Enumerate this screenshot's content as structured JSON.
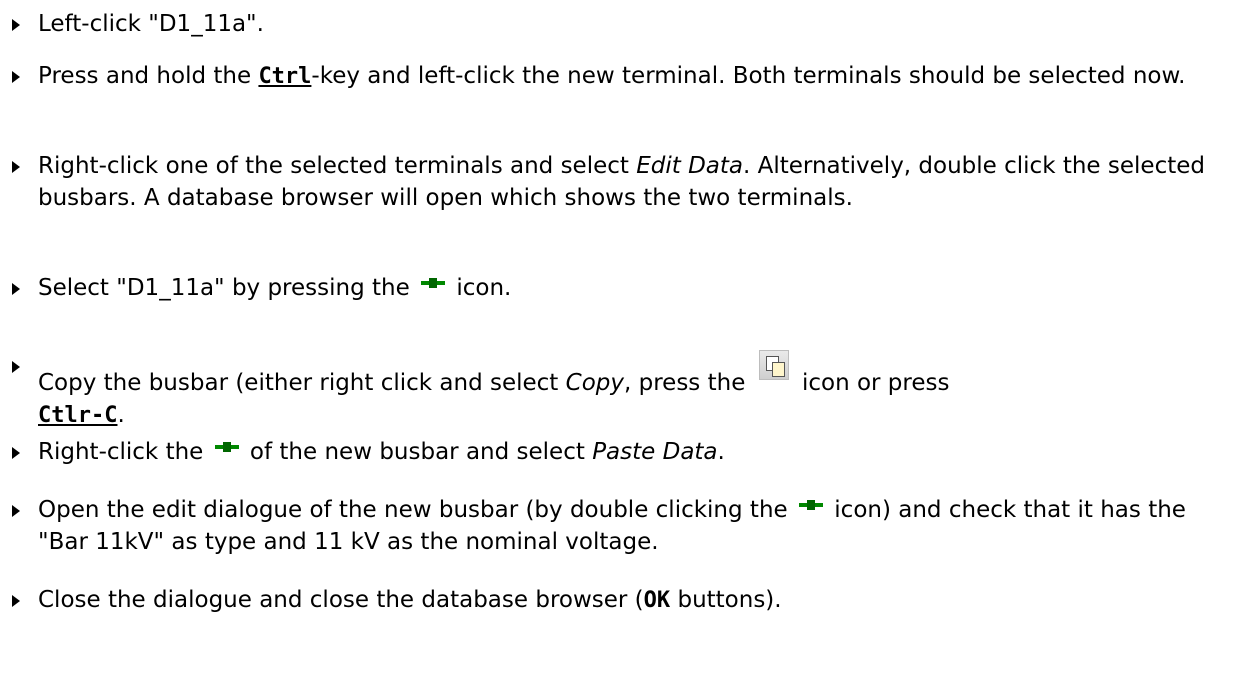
{
  "steps": [
    {
      "t1": "Left-click \"D1_11a\"."
    },
    {
      "t1": "Press and hold the ",
      "key": "Ctrl",
      "t2": "-key and left-click the new terminal. Both terminals should be selected now."
    },
    {
      "t1": "Right-click one of the selected terminals and select ",
      "em": "Edit Data",
      "t2": ". Alternatively, double click the selected busbars. A database browser will open which shows the two terminals."
    },
    {
      "t1": "Select \"D1_11a\" by pressing the ",
      "icon": "busbar-icon",
      "t2": " icon."
    },
    {
      "t1": "Copy the busbar (either right click and select ",
      "em": "Copy",
      "t2": ", press the ",
      "icon": "copy-icon",
      "t3": " icon or press ",
      "key": "Ctlr-C",
      "t4": "."
    },
    {
      "t1": "Right-click the ",
      "icon": "busbar-icon",
      "t2": " of the new busbar and select ",
      "em": "Paste Data",
      "t3": "."
    },
    {
      "t1": "Open the edit dialogue of the new busbar (by double clicking the ",
      "icon": "busbar-icon",
      "t2": " icon) and check that it has the \"Bar 11kV\" as type and 11 kV as the nominal voltage."
    },
    {
      "t1": "Close the dialogue and close the database browser (",
      "key": "OK",
      "t2": " buttons)."
    }
  ],
  "colors": {
    "text": "#000000",
    "busbar_icon": "#008800"
  }
}
